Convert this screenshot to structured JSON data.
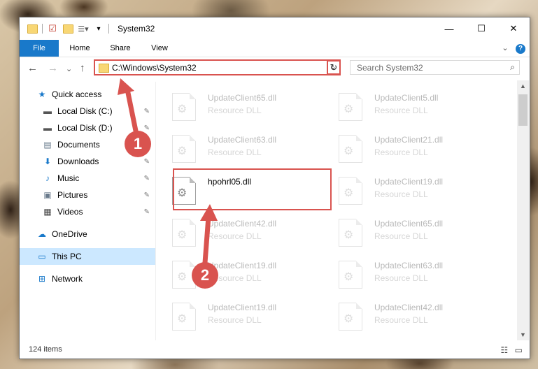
{
  "window": {
    "title": "System32",
    "controls": {
      "minimize": "—",
      "maximize": "☐",
      "close": "✕"
    }
  },
  "ribbon": {
    "tabs": [
      "File",
      "Home",
      "Share",
      "View"
    ],
    "expand": "⌄",
    "help": "?"
  },
  "address": {
    "path": "C:\\Windows\\System32",
    "chevron": "⌄",
    "refresh": "↻",
    "search_placeholder": "Search System32",
    "search_icon": "⌕"
  },
  "nav": {
    "back": "←",
    "forward": "→",
    "recent": "⌄",
    "up": "↑"
  },
  "sidebar": {
    "quick_access": "Quick access",
    "items": [
      {
        "label": "Local Disk (C:)",
        "icon": "drive-icon",
        "pinned": true
      },
      {
        "label": "Local Disk (D:)",
        "icon": "drive-icon",
        "pinned": true
      },
      {
        "label": "Documents",
        "icon": "documents-icon",
        "pinned": true
      },
      {
        "label": "Downloads",
        "icon": "downloads-icon",
        "pinned": true
      },
      {
        "label": "Music",
        "icon": "music-icon",
        "pinned": true
      },
      {
        "label": "Pictures",
        "icon": "pictures-icon",
        "pinned": true
      },
      {
        "label": "Videos",
        "icon": "videos-icon",
        "pinned": true
      }
    ],
    "onedrive": "OneDrive",
    "this_pc": "This PC",
    "network": "Network"
  },
  "files": [
    {
      "name": "UpdateClient65.dll",
      "type": "Resource DLL"
    },
    {
      "name": "UpdateClient5.dll",
      "type": "Resource DLL"
    },
    {
      "name": "UpdateClient63.dll",
      "type": "Resource DLL"
    },
    {
      "name": "UpdateClient21.dll",
      "type": "Resource DLL"
    },
    {
      "name": "hpohrl05.dll",
      "type": ""
    },
    {
      "name": "UpdateClient19.dll",
      "type": "Resource DLL"
    },
    {
      "name": "UpdateClient42.dll",
      "type": "Resource DLL"
    },
    {
      "name": "UpdateClient65.dll",
      "type": "Resource DLL"
    },
    {
      "name": "UpdateClient19.dll",
      "type": "Resource DLL"
    },
    {
      "name": "UpdateClient63.dll",
      "type": "Resource DLL"
    },
    {
      "name": "UpdateClient19.dll",
      "type": "Resource DLL"
    },
    {
      "name": "UpdateClient42.dll",
      "type": "Resource DLL"
    }
  ],
  "status": {
    "count": "124 items",
    "details_view": "☷",
    "tiles_view": "▭"
  },
  "callouts": {
    "one": "1",
    "two": "2"
  },
  "colors": {
    "accent": "#1979ca",
    "highlight": "#d9534f",
    "selected": "#cce8ff"
  }
}
